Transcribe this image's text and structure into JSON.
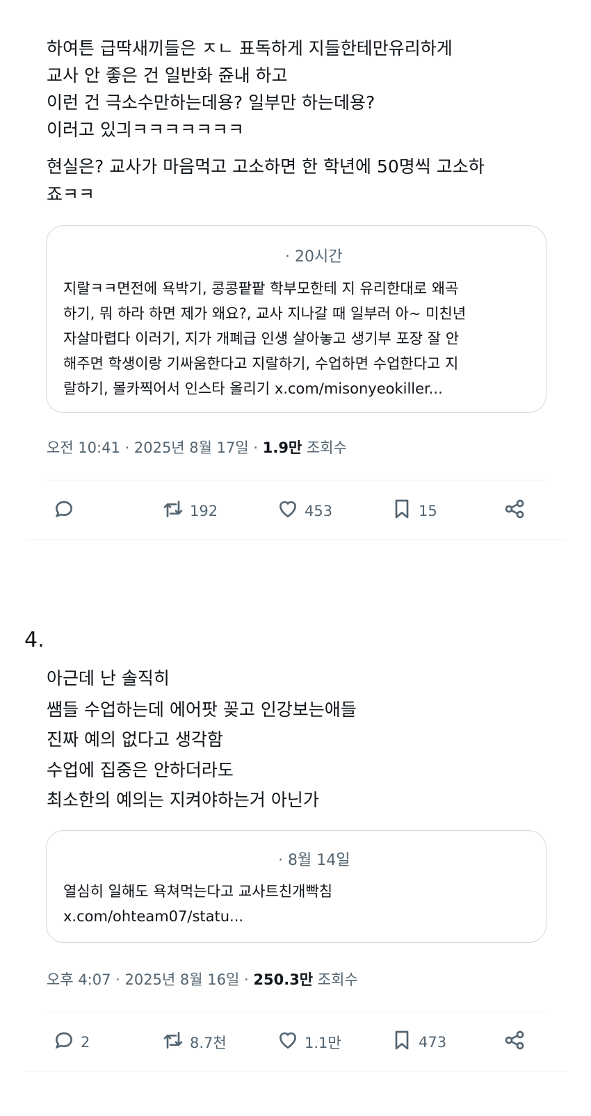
{
  "tweet1": {
    "body_lines": [
      "하여튼 급딱새끼들은 ㅈㄴ 표독하게 지들한테만유리하게",
      "교사 안 좋은 건 일반화 쥰내 하고",
      "이런 건 극소수만하는데용? 일부만 하는데용?",
      "이러고 있긔ㅋㅋㅋㅋㅋㅋㅋ",
      "현실은? 교사가 마음먹고 고소하면 한 학년에 50명씩 고소하",
      "죠ㅋㅋ"
    ],
    "quote": {
      "time": "· 20시간",
      "lines": [
        "지랄ㅋㅋ면전에 욕박기, 콩콩팥팥 학부모한테 지 유리한대로 왜곡",
        "하기, 뭐 하라 하면 제가 왜요?, 교사 지나갈 때 일부러 아~ 미친년",
        "자살마렵다 이러기, 지가 개폐급 인생 살아놓고 생기부 포장 잘 안",
        "해주면 학생이랑 기싸움한다고 지랄하기, 수업하면 수업한다고 지",
        "랄하기, 몰카찍어서 인스타 올리기 x.com/misonyeokiller..."
      ]
    },
    "meta": {
      "time": "오전 10:41 · 2025년 8월 17일 · ",
      "views": "1.9만",
      "views_label": " 조회수"
    },
    "actions": {
      "reply": "",
      "retweet": "192",
      "like": "453",
      "bookmark": "15"
    }
  },
  "tweet2": {
    "number_label": "4.",
    "body_lines": [
      "아근데 난 솔직히",
      "쌤들 수업하는데 에어팟 꽂고 인강보는애들",
      "진짜 예의 없다고 생각함",
      "수업에 집중은 안하더라도",
      "최소한의 예의는 지켜야하는거 아닌가"
    ],
    "quote": {
      "time": "· 8월 14일",
      "lines": [
        "열심히 일해도 욕쳐먹는다고 교사트친개빡침",
        "x.com/ohteam07/statu..."
      ]
    },
    "meta": {
      "time": "오후 4:07 · 2025년 8월 16일 · ",
      "views": "250.3만",
      "views_label": " 조회수"
    },
    "actions": {
      "reply": "2",
      "retweet": "8.7천",
      "like": "1.1만",
      "bookmark": "473"
    }
  },
  "icons": [
    "reply-icon",
    "retweet-icon",
    "like-icon",
    "bookmark-icon",
    "share-icon"
  ],
  "colors": {
    "text": "#0f1419",
    "secondary": "#536471",
    "border": "#cfd9de",
    "divider": "#eff3f4"
  }
}
